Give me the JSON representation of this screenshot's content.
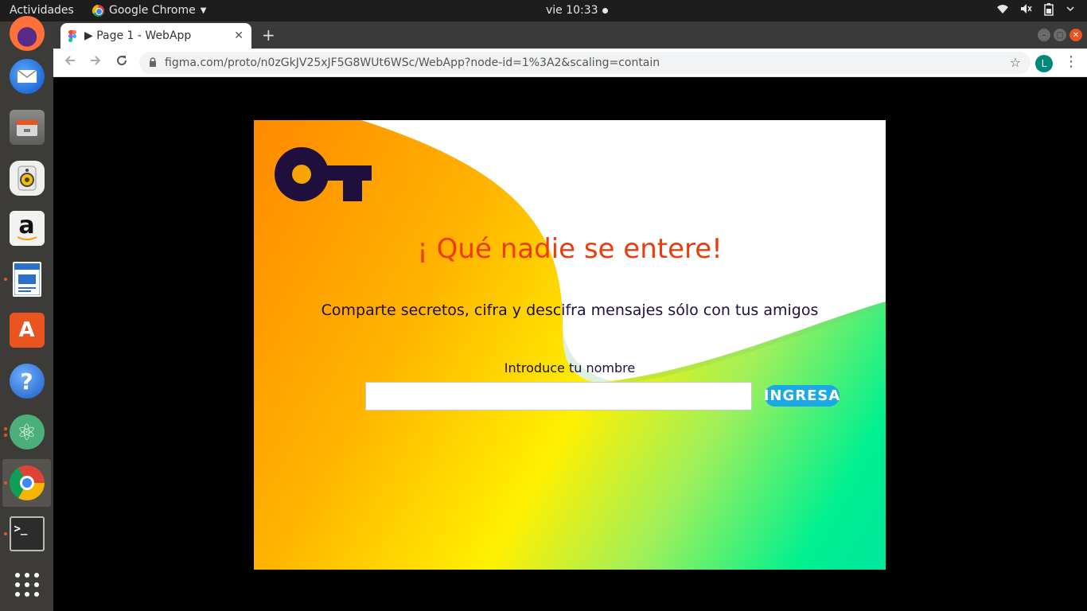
{
  "topbar": {
    "activities": "Actividades",
    "app_name": "Google Chrome",
    "clock": "vie 10:33",
    "tray_icons": [
      "wifi-icon",
      "volume-icon",
      "battery-icon",
      "power-menu-icon"
    ]
  },
  "dock": {
    "items": [
      {
        "name": "firefox-icon"
      },
      {
        "name": "thunderbird-icon"
      },
      {
        "name": "files-icon"
      },
      {
        "name": "rhythmbox-icon"
      },
      {
        "name": "amazon-icon",
        "glyph": "a"
      },
      {
        "name": "libreoffice-writer-icon"
      },
      {
        "name": "software-center-icon",
        "glyph": "A"
      },
      {
        "name": "help-icon",
        "glyph": "?"
      },
      {
        "name": "atom-icon",
        "glyph": "⚛"
      },
      {
        "name": "chrome-icon"
      },
      {
        "name": "terminal-icon",
        "glyph": ">_"
      },
      {
        "name": "show-apps-icon",
        "glyph": "⋮⋮⋮"
      }
    ]
  },
  "browser": {
    "tab_title": "▶ Page 1 - WebApp",
    "tab_close": "✕",
    "new_tab": "+",
    "url": "figma.com/proto/n0zGkJV25xJF5G8WUt6WSc/WebApp?node-id=1%3A2&scaling=contain",
    "avatar_letter": "L"
  },
  "app": {
    "headline": "¡ Qué nadie se entere!",
    "subtitle": "Comparte secretos, cifra y descifra mensajes sólo con tus amigos",
    "name_label": "Introduce tu nombre",
    "name_value": "",
    "submit_label": "INGRESA",
    "colors": {
      "headline": "#ee3a0c",
      "text": "#1e0f3c",
      "key": "#1e0f3c",
      "button": "#1aa8e6"
    }
  }
}
